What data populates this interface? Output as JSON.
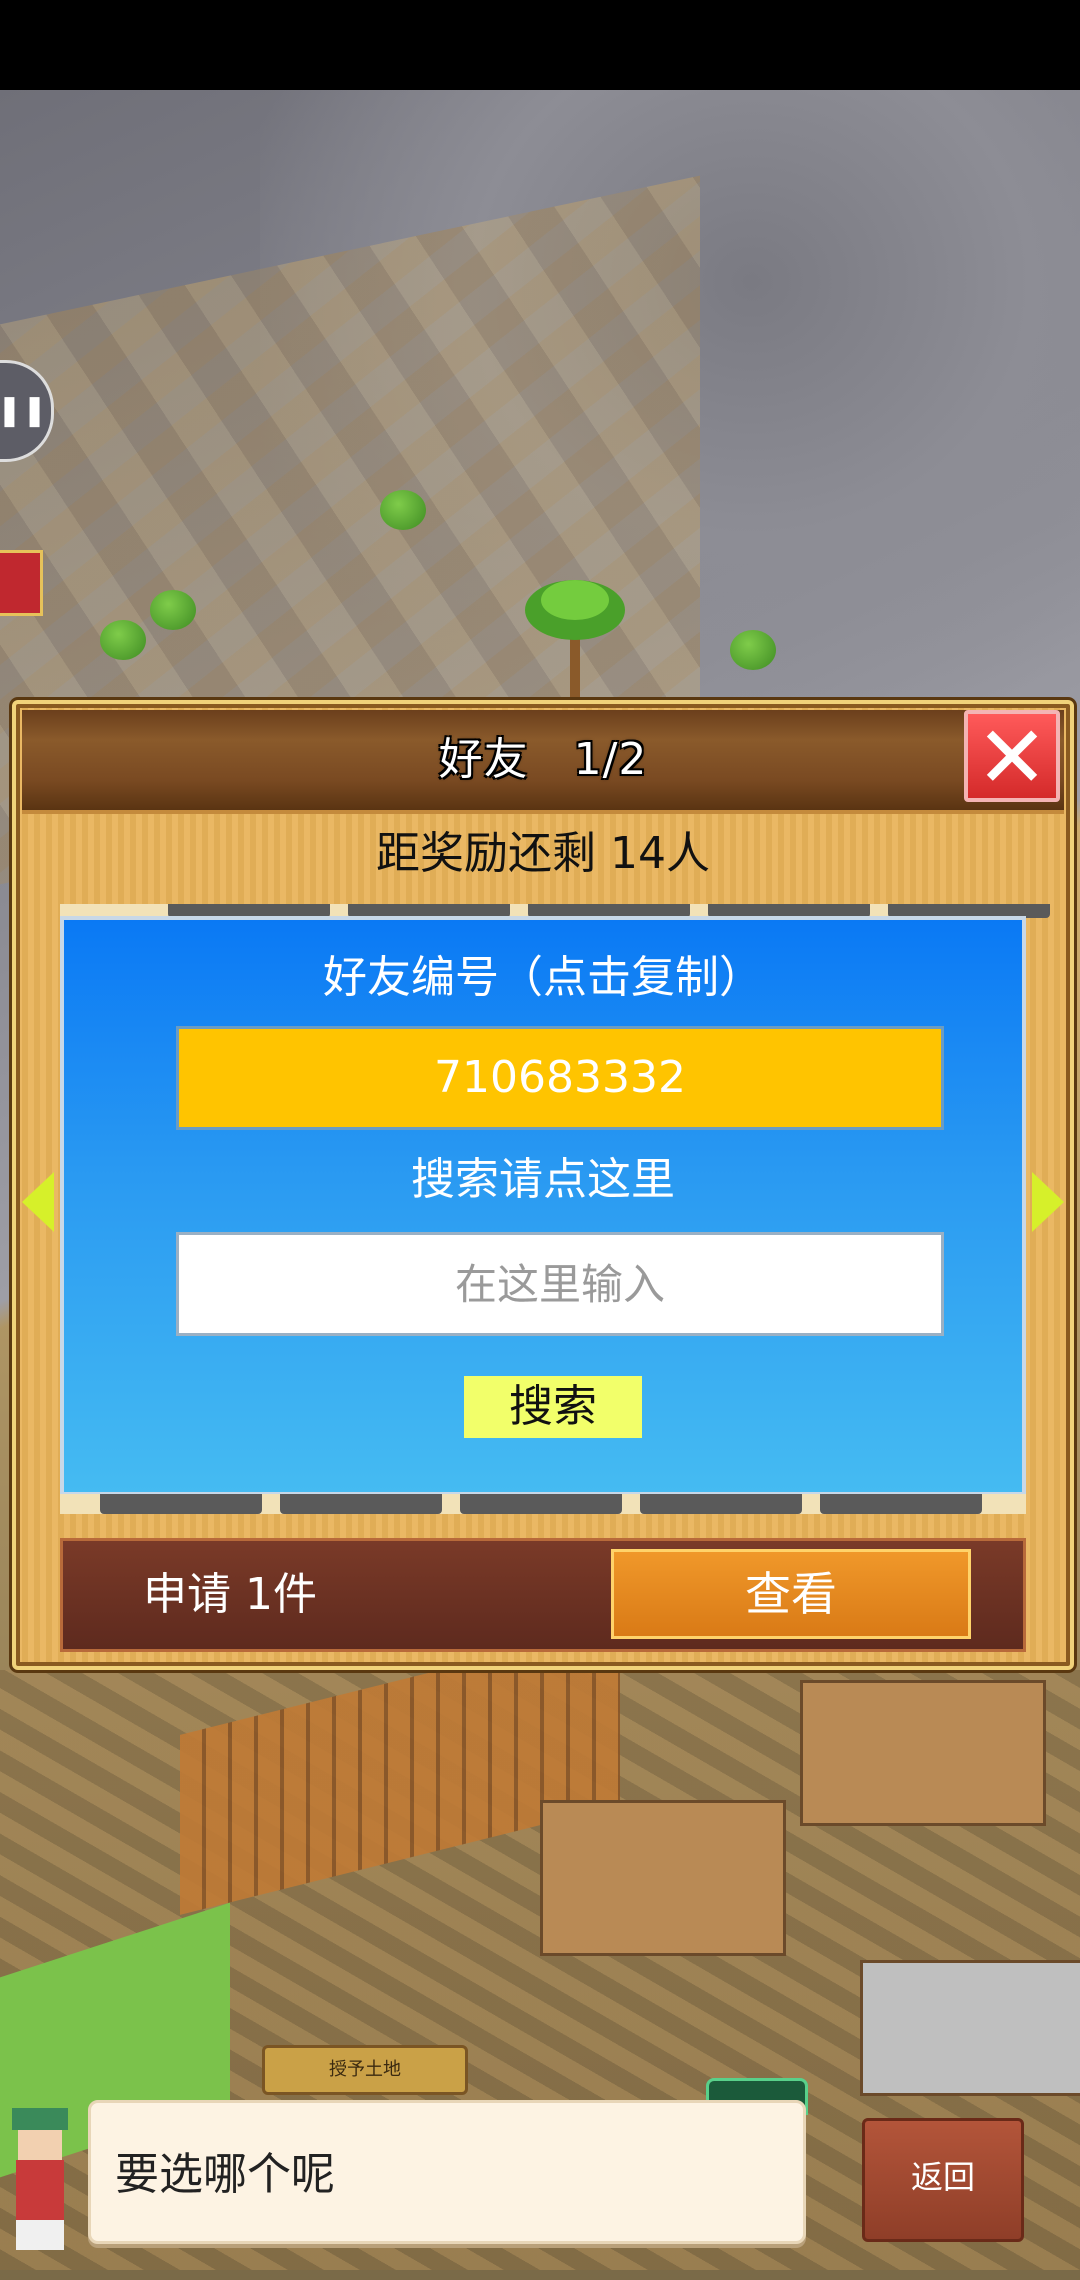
{
  "dialog": {
    "title": "好友　1/2",
    "close_icon": "✕",
    "reward_text": "距奖励还剩 14人",
    "friend_id_label": "好友编号（点击复制）",
    "friend_id_value": "710683332",
    "search_label": "搜索请点这里",
    "search_placeholder": "在这里输入",
    "search_button": "搜索",
    "request_text": "申请 1件",
    "view_button": "查看"
  },
  "map": {
    "land_sign": "授予土地"
  },
  "bottom": {
    "speech_text": "要选哪个呢",
    "back_button": "返回"
  },
  "icons": {
    "pause": "pause-icon",
    "close": "close-icon",
    "left_arrow": "chevron-left-icon",
    "right_arrow": "chevron-right-icon"
  },
  "colors": {
    "panel": "#e9b45a",
    "header": "#6b3f1c",
    "blue_box": "#0a79f4",
    "friend_id_bg": "#ffc400",
    "search_button_bg": "#f2ff6a",
    "view_button_bg": "#e88a20",
    "close_button_bg": "#e83a3a"
  }
}
